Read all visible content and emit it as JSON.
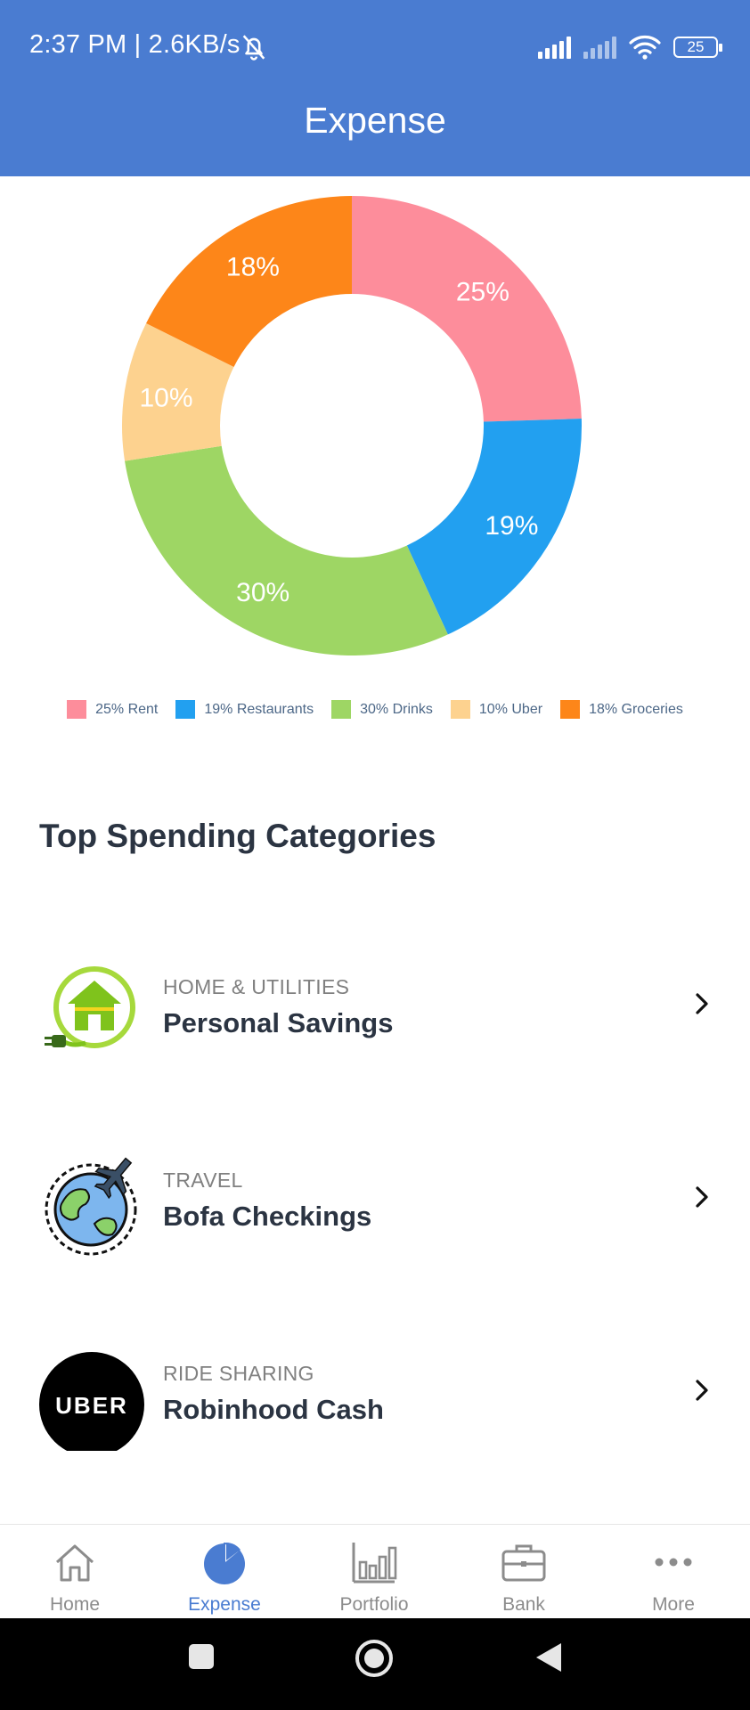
{
  "status_bar": {
    "time_speed": "2:37 PM | 2.6KB/s",
    "battery": "25"
  },
  "header": {
    "title": "Expense"
  },
  "chart_data": {
    "type": "pie",
    "donut": true,
    "categories": [
      "Rent",
      "Restaurants",
      "Drinks",
      "Uber",
      "Groceries"
    ],
    "values": [
      25,
      19,
      30,
      10,
      18
    ],
    "slice_labels": [
      "25%",
      "19%",
      "30%",
      "10%",
      "18%"
    ],
    "legend": [
      "25% Rent",
      "19% Restaurants",
      "30% Drinks",
      "10% Uber",
      "18% Groceries"
    ],
    "colors": [
      "#fd8d9b",
      "#22a0f0",
      "#9ed664",
      "#fdd28f",
      "#fd8619"
    ],
    "legend_position": "bottom"
  },
  "section": {
    "title": "Top Spending Categories"
  },
  "spending": [
    {
      "category": "HOME & UTILITIES",
      "name": "Personal Savings",
      "icon": "home-utilities-icon"
    },
    {
      "category": "TRAVEL",
      "name": "Bofa Checkings",
      "icon": "travel-globe-icon"
    },
    {
      "category": "RIDE SHARING",
      "name": "Robinhood Cash",
      "icon": "uber-logo-icon",
      "logo_text": "UBER"
    }
  ],
  "nav": {
    "items": [
      {
        "label": "Home",
        "icon": "home-icon"
      },
      {
        "label": "Expense",
        "icon": "pie-chart-icon",
        "active": true
      },
      {
        "label": "Portfolio",
        "icon": "bar-chart-icon"
      },
      {
        "label": "Bank",
        "icon": "briefcase-icon"
      },
      {
        "label": "More",
        "icon": "more-dots-icon"
      }
    ]
  },
  "colors": {
    "brand": "#4a7cd1",
    "active_nav": "#4a7cd1",
    "inactive_nav": "#8c8c8c"
  }
}
